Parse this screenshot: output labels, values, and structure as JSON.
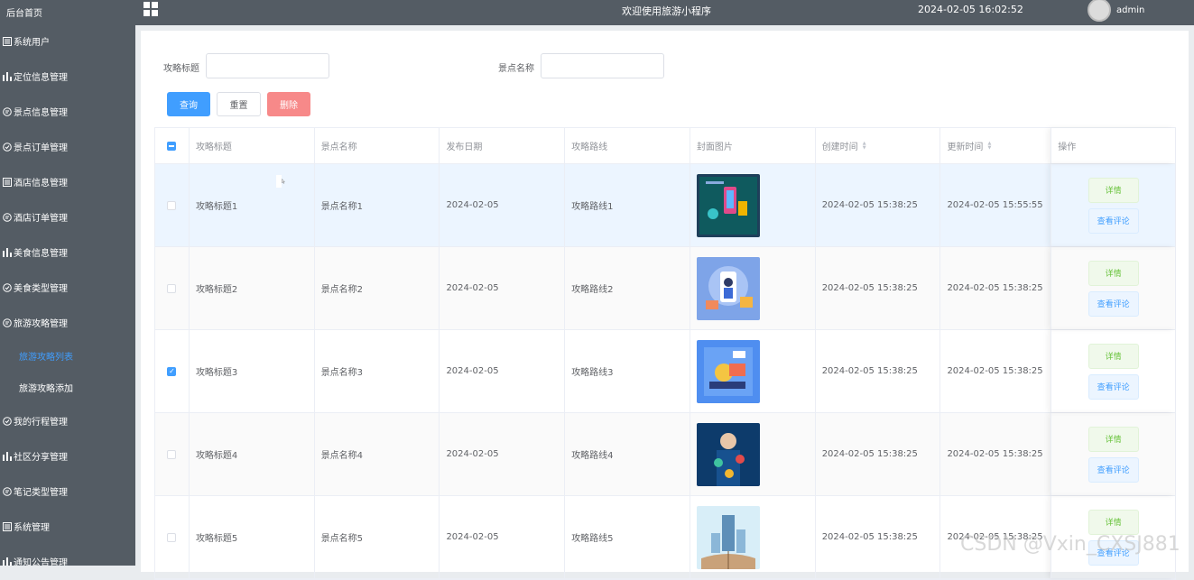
{
  "sidebar": {
    "home": "后台首页",
    "items": [
      {
        "label": "系统用户",
        "icon": "list-icon"
      },
      {
        "label": "定位信息管理",
        "icon": "bar-chart-icon"
      },
      {
        "label": "景点信息管理",
        "icon": "chat-icon"
      },
      {
        "label": "景点订单管理",
        "icon": "check-circle-icon"
      },
      {
        "label": "酒店信息管理",
        "icon": "list-icon"
      },
      {
        "label": "酒店订单管理",
        "icon": "chat-icon"
      },
      {
        "label": "美食信息管理",
        "icon": "bar-chart-icon"
      },
      {
        "label": "美食类型管理",
        "icon": "check-circle-icon"
      },
      {
        "label": "旅游攻略管理",
        "icon": "chat-icon"
      }
    ],
    "sub_items": [
      {
        "label": "旅游攻略列表",
        "active": true
      },
      {
        "label": "旅游攻略添加",
        "active": false
      }
    ],
    "items_after": [
      {
        "label": "我的行程管理",
        "icon": "check-circle-icon"
      },
      {
        "label": "社区分享管理",
        "icon": "bar-chart-icon"
      },
      {
        "label": "笔记类型管理",
        "icon": "chat-icon"
      },
      {
        "label": "系统管理",
        "icon": "list-icon"
      },
      {
        "label": "通知公告管理",
        "icon": "bar-chart-icon"
      }
    ]
  },
  "header": {
    "title": "欢迎使用旅游小程序",
    "datetime": "2024-02-05 16:02:52",
    "username": "admin"
  },
  "search": {
    "title_label": "攻略标题",
    "title_value": "",
    "spot_label": "景点名称",
    "spot_value": "",
    "query_button": "查询",
    "reset_button": "重置",
    "delete_button": "删除"
  },
  "table": {
    "columns": [
      "攻略标题",
      "景点名称",
      "发布日期",
      "攻略路线",
      "封面图片",
      "创建时间",
      "更新时间",
      "操作"
    ],
    "rows": [
      {
        "title": "攻略标题1",
        "spot": "景点名称1",
        "date": "2024-02-05",
        "route": "攻略路线1",
        "created": "2024-02-05 15:38:25",
        "updated": "2024-02-05 15:55:55",
        "checked": false
      },
      {
        "title": "攻略标题2",
        "spot": "景点名称2",
        "date": "2024-02-05",
        "route": "攻略路线2",
        "created": "2024-02-05 15:38:25",
        "updated": "2024-02-05 15:38:25",
        "checked": false
      },
      {
        "title": "攻略标题3",
        "spot": "景点名称3",
        "date": "2024-02-05",
        "route": "攻略路线3",
        "created": "2024-02-05 15:38:25",
        "updated": "2024-02-05 15:38:25",
        "checked": true
      },
      {
        "title": "攻略标题4",
        "spot": "景点名称4",
        "date": "2024-02-05",
        "route": "攻略路线4",
        "created": "2024-02-05 15:38:25",
        "updated": "2024-02-05 15:38:25",
        "checked": false
      },
      {
        "title": "攻略标题5",
        "spot": "景点名称5",
        "date": "2024-02-05",
        "route": "攻略路线5",
        "created": "2024-02-05 15:38:25",
        "updated": "2024-02-05 15:38:25",
        "checked": false
      }
    ],
    "detail_button": "详情",
    "comment_button": "查看评论"
  },
  "watermark": "CSDN @Vxin_CXSJ881",
  "colors": {
    "sidebar_bg": "#545c64",
    "primary": "#409eff",
    "danger": "#f78989",
    "success": "#67c23a"
  }
}
